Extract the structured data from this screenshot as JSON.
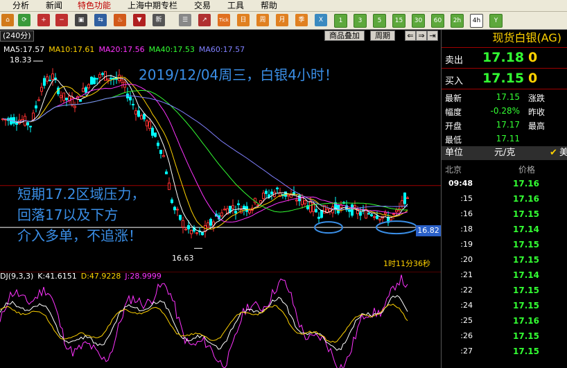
{
  "menu": {
    "items": [
      "分析",
      "新闻",
      "特色功能",
      "上海中期专栏",
      "交易",
      "工具",
      "帮助"
    ]
  },
  "toolbar": {
    "period_buttons": [
      "1",
      "3",
      "5",
      "15",
      "30",
      "60",
      "2h",
      "4h",
      "Y"
    ],
    "selected_period": "4h",
    "icon_labels": [
      "Tick",
      "日",
      "周",
      "月",
      "季",
      "X"
    ]
  },
  "chart": {
    "period_label": "(240分)",
    "overlay_button": "商品叠加",
    "cycle_button": "周期",
    "ma_legend": [
      {
        "text": "MA5:17.57",
        "color": "#ffffff"
      },
      {
        "text": "MA10:17.61",
        "color": "#ffd200"
      },
      {
        "text": "MA20:17.56",
        "color": "#ff33ff"
      },
      {
        "text": "MA40:17.53",
        "color": "#33ff33"
      },
      {
        "text": "MA60:17.57",
        "color": "#8080ff"
      }
    ],
    "high_label": "18.33",
    "low_label": "16.63",
    "current_price_tag": "16.82",
    "title_annotation": "2019/12/04周三，白银4小时！",
    "note_lines": [
      "短期17.2区域压力，",
      "回落17以及下方",
      "介入多单，不追涨！"
    ],
    "countdown": "1时11分36秒",
    "kdj_legend": [
      {
        "text": "DJ(9,3,3)",
        "color": "#ffffff"
      },
      {
        "text": "K:41.6151",
        "color": "#ffffff"
      },
      {
        "text": "D:47.9228",
        "color": "#ffd200"
      },
      {
        "text": "J:28.9999",
        "color": "#ff33ff"
      }
    ]
  },
  "quote": {
    "name": "现货白银(AG)",
    "sell_label": "卖出",
    "sell_price": "17.18",
    "sell_vol": "0",
    "buy_label": "买入",
    "buy_price": "17.15",
    "buy_vol": "0",
    "rows": [
      {
        "label": "最新",
        "value": "17.15",
        "label2": "涨跌"
      },
      {
        "label": "幅度",
        "value": "-0.28%",
        "label2": "昨收"
      },
      {
        "label": "开盘",
        "value": "17.17",
        "label2": "最高"
      },
      {
        "label": "最低",
        "value": "17.11",
        "label2": ""
      }
    ],
    "unit_label": "单位",
    "unit_value": "元/克",
    "unit_extra": "美",
    "tick_head_left": "北京",
    "tick_head_right": "价格",
    "ticks": [
      {
        "time": "09:48",
        "price": "17.16"
      },
      {
        "time": ":15",
        "price": "17.16"
      },
      {
        "time": ":16",
        "price": "17.15"
      },
      {
        "time": ":18",
        "price": "17.14"
      },
      {
        "time": ":19",
        "price": "17.15"
      },
      {
        "time": ":20",
        "price": "17.15"
      },
      {
        "time": ":21",
        "price": "17.14"
      },
      {
        "time": ":22",
        "price": "17.15"
      },
      {
        "time": ":24",
        "price": "17.15"
      },
      {
        "time": ":25",
        "price": "17.16"
      },
      {
        "time": ":26",
        "price": "17.15"
      },
      {
        "time": ":27",
        "price": "17.15"
      }
    ]
  },
  "colors": {
    "up": "#ff3333",
    "down": "#00ffff",
    "green": "#33ff33",
    "yellow": "#ffd200",
    "magenta": "#ff33ff",
    "annotation": "#3a8ee6"
  }
}
